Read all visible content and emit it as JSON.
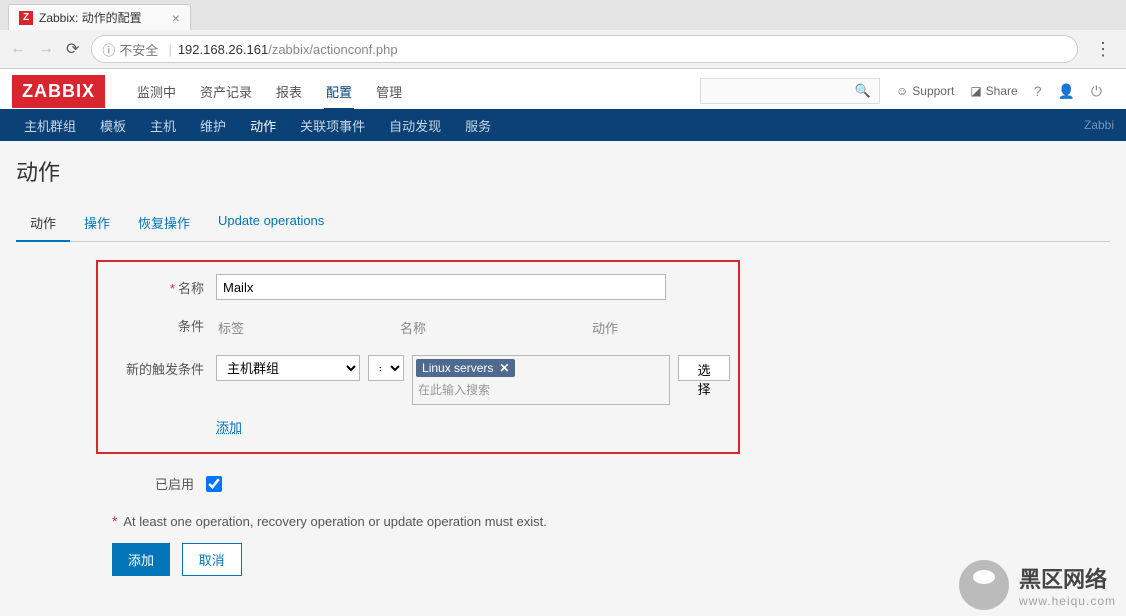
{
  "browser": {
    "tab_title": "Zabbix: 动作的配置",
    "insecure_label": "不安全",
    "url_host": "192.168.26.161",
    "url_path": "/zabbix/actionconf.php"
  },
  "header": {
    "logo": "ZABBIX",
    "menu": [
      "监测中",
      "资产记录",
      "报表",
      "配置",
      "管理"
    ],
    "active_index": 3,
    "support": "Support",
    "share": "Share"
  },
  "subnav": {
    "items": [
      "主机群组",
      "模板",
      "主机",
      "维护",
      "动作",
      "关联项事件",
      "自动发现",
      "服务"
    ],
    "active_index": 4,
    "right_text": "Zabbi"
  },
  "page": {
    "title": "动作",
    "tabs": [
      "动作",
      "操作",
      "恢复操作",
      "Update operations"
    ],
    "active_tab": 0
  },
  "form": {
    "name_label": "名称",
    "name_value": "Mailx",
    "cond_label": "条件",
    "cond_headers": [
      "标签",
      "名称",
      "动作"
    ],
    "newtrig_label": "新的触发条件",
    "select_type": "主机群组",
    "select_op": "=",
    "tag_value": "Linux servers",
    "ms_placeholder": "在此输入搜索",
    "btn_select": "选择",
    "link_add": "添加",
    "enabled_label": "已启用",
    "note": "At least one operation, recovery operation or update operation must exist.",
    "btn_add": "添加",
    "btn_cancel": "取消"
  },
  "watermark": {
    "title": "黑区网络",
    "sub": "www.heiqu.com"
  }
}
